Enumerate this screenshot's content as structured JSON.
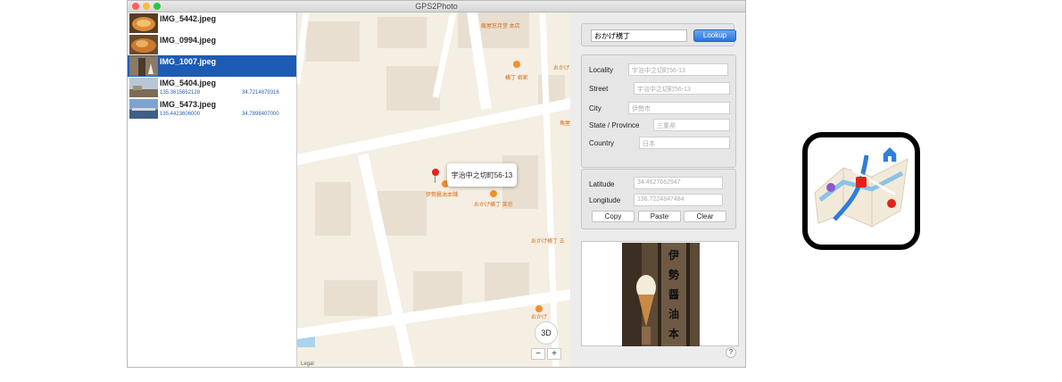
{
  "window": {
    "title": "GPS2Photo"
  },
  "sidebar": {
    "items": [
      {
        "name": "IMG_5442.jpeg",
        "lon": "",
        "lat": ""
      },
      {
        "name": "IMG_0994.jpeg",
        "lon": "",
        "lat": ""
      },
      {
        "name": "IMG_1007.jpeg",
        "lon": "",
        "lat": ""
      },
      {
        "name": "IMG_5404.jpeg",
        "lon": "135.3615652128",
        "lat": "34.7214879316"
      },
      {
        "name": "IMG_5473.jpeg",
        "lon": "135.4423606000",
        "lat": "34.7898407000"
      }
    ]
  },
  "map": {
    "callout": "宇治中之切町56-13",
    "poi_labels": [
      "藤屋窓月堂 本店",
      "横丁 君家",
      "おかげ",
      "角屋",
      "伊勢醤油本舗",
      "おかげ横丁 宮忠",
      "おかげ横丁 五",
      "おかげ"
    ],
    "button_3d": "3D",
    "zoom_out": "−",
    "zoom_in": "+",
    "legal": "Legal"
  },
  "lookup": {
    "value": "おかげ横丁",
    "button": "Lookup"
  },
  "address": {
    "locality_label": "Locality",
    "locality_value": "宇治中之切町56-13",
    "street_label": "Street",
    "street_value": "宇治中之切町56-13",
    "city_label": "City",
    "city_value": "伊勢市",
    "state_label": "State / Province",
    "state_value": "三重県",
    "country_label": "Country",
    "country_value": "日本"
  },
  "coords": {
    "latitude_label": "Latitude",
    "latitude_value": "34.4627662947",
    "longitude_label": "Longitude",
    "longitude_value": "136.7224847484",
    "copy": "Copy",
    "paste": "Paste",
    "clear": "Clear"
  },
  "photo": {
    "sign_text": "伊勢醤油本"
  },
  "help": "?",
  "colors": {
    "selection": "#1e5bb5",
    "pin": "#e2231a",
    "poi": "#f0912a",
    "lookup_button": "#2f74d8"
  }
}
